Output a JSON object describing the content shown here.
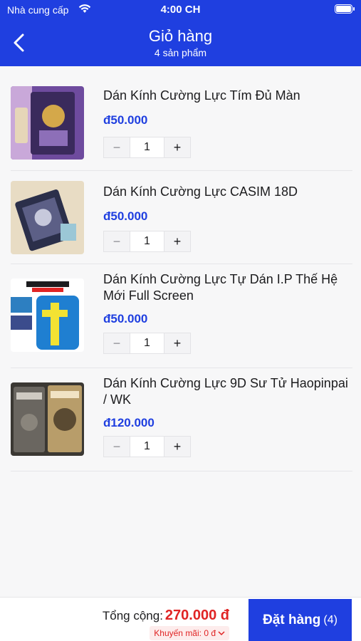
{
  "status_bar": {
    "carrier": "Nhà cung cấp",
    "time": "4:00 CH"
  },
  "header": {
    "title": "Giỏ hàng",
    "subtitle": "4 sản phẩm"
  },
  "items": [
    {
      "name": "Dán Kính Cường Lực Tím Đủ Màn",
      "price": "đ50.000",
      "qty": "1"
    },
    {
      "name": "Dán Kính Cường Lực CASIM 18D",
      "price": "đ50.000",
      "qty": "1"
    },
    {
      "name": "Dán Kính Cường Lực Tự Dán I.P Thế Hệ Mới Full Screen",
      "price": "đ50.000",
      "qty": "1"
    },
    {
      "name": "Dán Kính Cường Lực 9D Sư Tử Haopinpai / WK",
      "price": "đ120.000",
      "qty": "1"
    }
  ],
  "qty_controls": {
    "minus": "−",
    "plus": "+"
  },
  "footer": {
    "total_label": "Tổng cộng:",
    "total_value": "270.000 đ",
    "promo": "Khuyến mãi: 0 đ",
    "order_label": "Đặt hàng",
    "order_count": "(4)"
  },
  "colors": {
    "brand": "#1f3fe0",
    "price": "#1f3fe0",
    "total": "#e02424"
  },
  "icons": [
    "wifi-icon",
    "battery-icon",
    "back-chevron-icon",
    "chevron-down-icon"
  ]
}
